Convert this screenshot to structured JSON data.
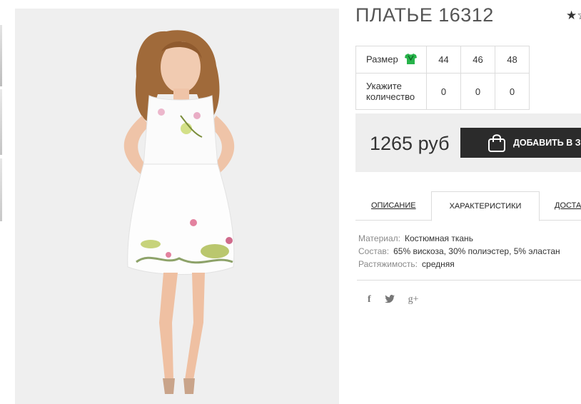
{
  "product": {
    "title": "ПЛАТЬЕ 16312",
    "rating_stars": "★☆"
  },
  "sizes": {
    "size_label": "Размер",
    "size_icon": "shirt-icon",
    "quantity_label_line1": "Укажите",
    "quantity_label_line2": "количество",
    "items": [
      {
        "size": "44",
        "qty": "0"
      },
      {
        "size": "46",
        "qty": "0"
      },
      {
        "size": "48",
        "qty": "0"
      }
    ]
  },
  "purchase": {
    "price": "1265 руб",
    "add_to_cart": "ДОБАВИТЬ В ЗАКАЗ"
  },
  "tabs": [
    {
      "label": "ОПИСАНИЕ",
      "active": false
    },
    {
      "label": "ХАРАКТЕРИСТИКИ",
      "active": true
    },
    {
      "label": "ДОСТАВКА",
      "active": false
    }
  ],
  "specs": [
    {
      "key": "Материал:",
      "value": "Костюмная ткань"
    },
    {
      "key": "Состав:",
      "value": "65% вискоза, 30% полиэстер, 5% эластан"
    },
    {
      "key": "Растяжимость:",
      "value": "средняя"
    }
  ],
  "social": {
    "facebook": "f",
    "twitter": "🐦",
    "googleplus": "g+"
  },
  "colors": {
    "accent_dark": "#2b2b2b",
    "price_bg": "#eeeeee",
    "shirt_icon": "#27b34a"
  }
}
